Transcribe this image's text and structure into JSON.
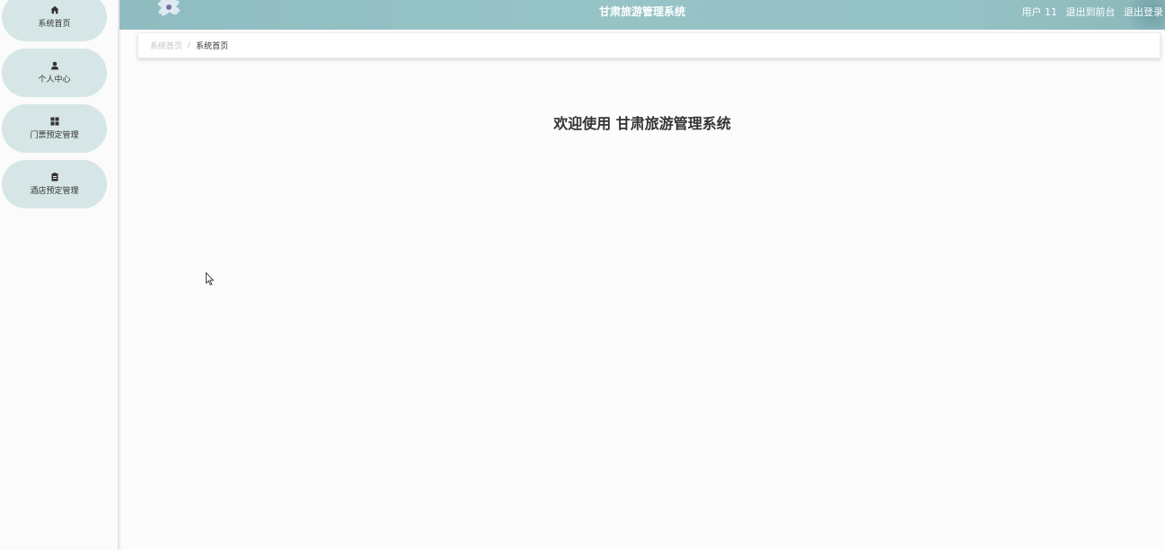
{
  "app": {
    "title": "甘肃旅游管理系统"
  },
  "sidebar": {
    "items": [
      {
        "label": "系统首页",
        "icon": "home-icon"
      },
      {
        "label": "个人中心",
        "icon": "user-icon"
      },
      {
        "label": "门票预定管理",
        "icon": "grid-icon"
      },
      {
        "label": "酒店预定管理",
        "icon": "document-icon"
      }
    ]
  },
  "header": {
    "user_label": "用户 11",
    "back_to_frontend": "退出到前台",
    "logout": "退出登录"
  },
  "breadcrumb": {
    "items": [
      "系统首页",
      "系统首页"
    ],
    "separator": "/"
  },
  "main": {
    "welcome": "欢迎使用 甘肃旅游管理系统"
  },
  "colors": {
    "header_bg": "#95c2c5",
    "menu_item_bg": "#d6e6e6"
  }
}
